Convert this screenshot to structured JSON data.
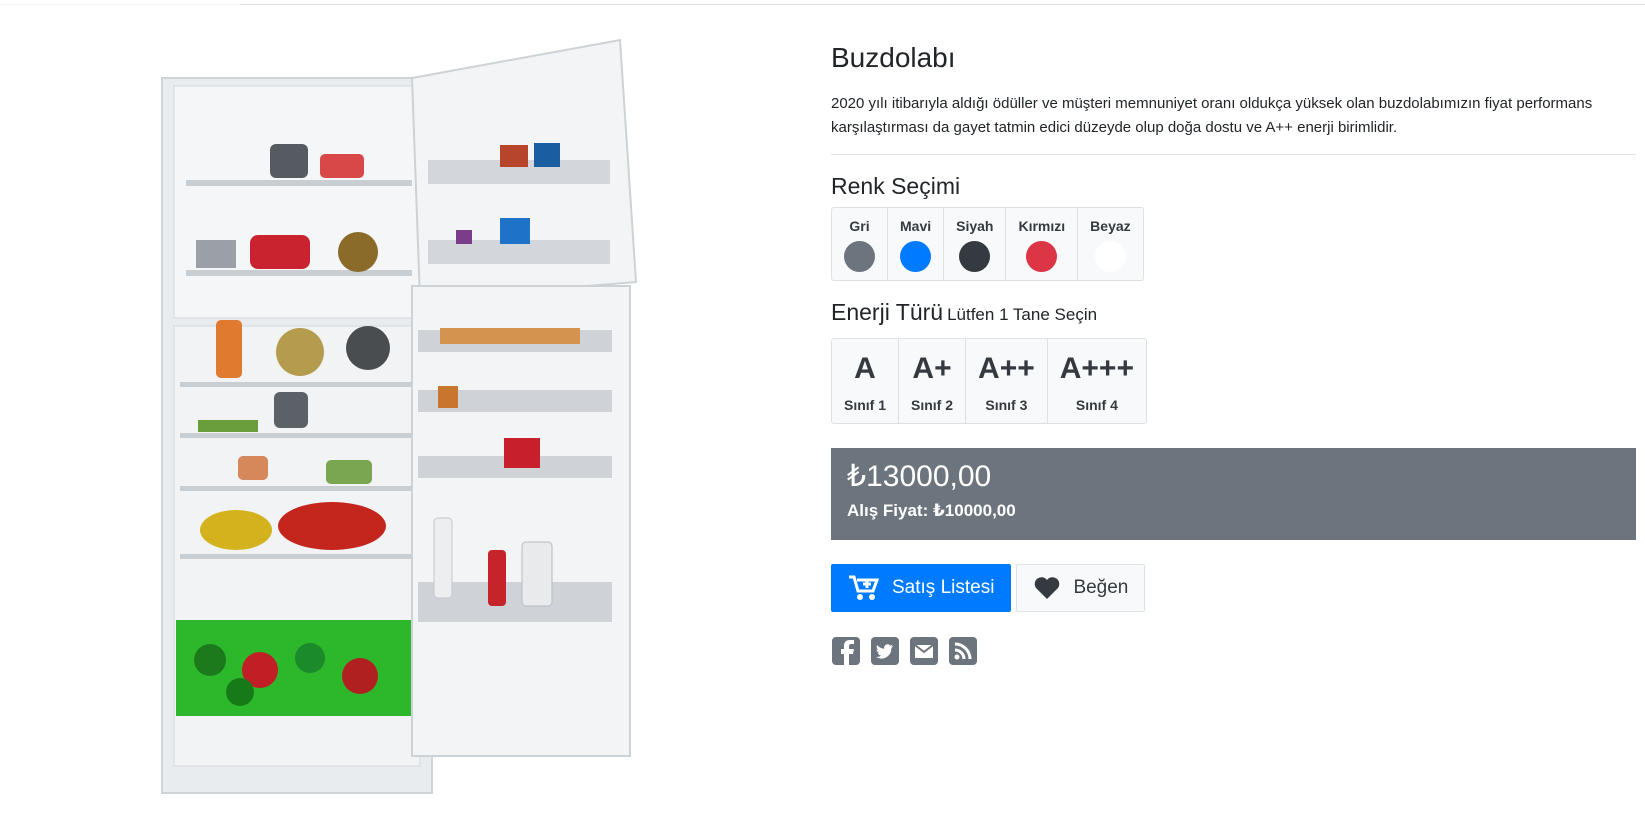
{
  "product": {
    "title": "Buzdolabı",
    "description": "2020 yılı itibarıyla aldığı ödüller ve müşteri memnuniyet oranı oldukça yüksek olan buzdolabımızın fiyat performans karşılaştırması da gayet tatmin edici düzeyde olup doğa dostu ve A++ enerji birimlidir."
  },
  "color_section": {
    "title": "Renk Seçimi",
    "options": [
      {
        "label": "Gri",
        "color": "#6c757d"
      },
      {
        "label": "Mavi",
        "color": "#007bff"
      },
      {
        "label": "Siyah",
        "color": "#343a40"
      },
      {
        "label": "Kırmızı",
        "color": "#dc3545"
      },
      {
        "label": "Beyaz",
        "color": "#ffffff"
      }
    ]
  },
  "energy_section": {
    "title": "Enerji Türü",
    "hint": "Lütfen 1 Tane Seçin",
    "options": [
      {
        "grade": "A",
        "label": "Sınıf 1"
      },
      {
        "grade": "A+",
        "label": "Sınıf 2"
      },
      {
        "grade": "A++",
        "label": "Sınıf 3"
      },
      {
        "grade": "A+++",
        "label": "Sınıf 4"
      }
    ]
  },
  "price": {
    "main": "₺13000,00",
    "purchase": "Alış Fiyat: ₺10000,00"
  },
  "actions": {
    "add_to_list": "Satış Listesi",
    "like": "Beğen"
  },
  "share": [
    "facebook-icon",
    "twitter-icon",
    "envelope-icon",
    "rss-icon"
  ],
  "colors": {
    "primary": "#007bff",
    "secondary": "#6c757d"
  }
}
